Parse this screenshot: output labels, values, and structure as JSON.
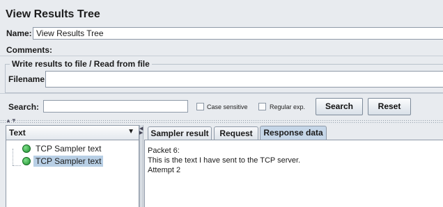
{
  "title": "View Results Tree",
  "name_label": "Name:",
  "name_value": "View Results Tree",
  "comments_label": "Comments:",
  "file_group_title": "Write results to file / Read from file",
  "filename_label": "Filename",
  "filename_value": "",
  "search_label": "Search:",
  "search_value": "",
  "case_sensitive_label": "Case sensitive",
  "regexp_label": "Regular exp.",
  "search_button": "Search",
  "reset_button": "Reset",
  "renderer_select": "Text",
  "tree_items": [
    {
      "label": "TCP Sampler text",
      "status": "success",
      "selected": false
    },
    {
      "label": "TCP Sampler text",
      "status": "success",
      "selected": true
    }
  ],
  "tabs": [
    "Sampler result",
    "Request",
    "Response data"
  ],
  "active_tab": "Response data",
  "response_lines": [
    "Packet 6:",
    "This is the text I have sent to the TCP server.",
    "Attempt 2"
  ],
  "icons": {
    "success": "green-check-shield-icon",
    "dropdown": "chevron-down-icon"
  }
}
